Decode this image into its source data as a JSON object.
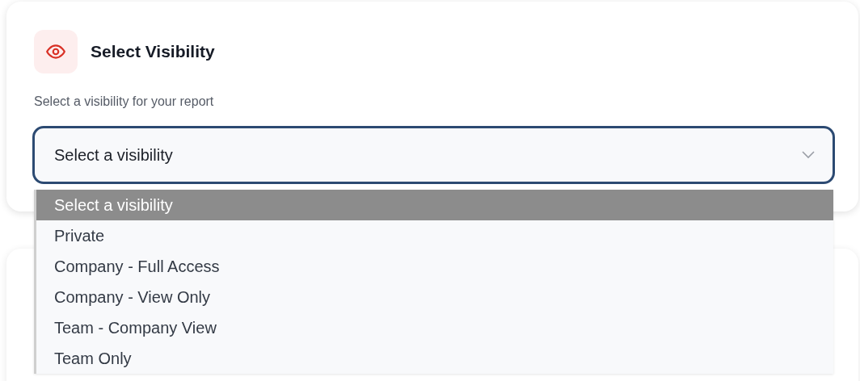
{
  "card": {
    "title": "Select Visibility",
    "subtitle": "Select a visibility for your report"
  },
  "select": {
    "value": "Select a visibility",
    "expanded": true,
    "options": [
      {
        "label": "Select a visibility",
        "selected": true
      },
      {
        "label": "Private",
        "selected": false
      },
      {
        "label": "Company - Full Access",
        "selected": false
      },
      {
        "label": "Company - View Only",
        "selected": false
      },
      {
        "label": "Team - Company View",
        "selected": false
      },
      {
        "label": "Team Only",
        "selected": false
      }
    ]
  }
}
